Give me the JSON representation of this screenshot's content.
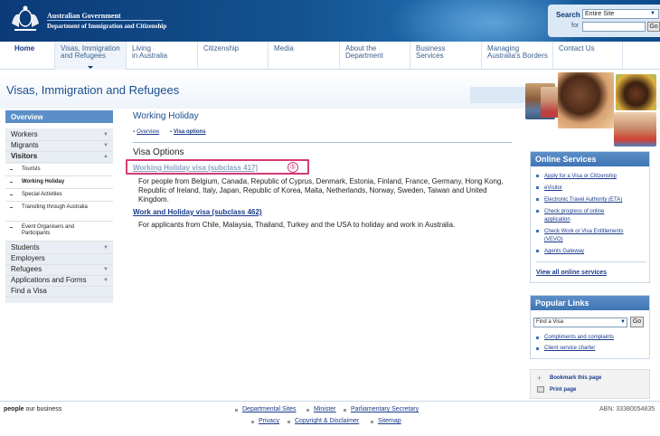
{
  "header": {
    "gov_title": "Australian Government",
    "dept_title": "Department of Immigration and Citizenship",
    "search": {
      "label": "Search",
      "scope": "Entire Site",
      "for_label": "for",
      "go": "Go"
    }
  },
  "nav": {
    "items": [
      {
        "line1": "Home",
        "line2": ""
      },
      {
        "line1": "Visas, Immigration",
        "line2": "and Refugees"
      },
      {
        "line1": "Living",
        "line2": "in Australia"
      },
      {
        "line1": "Citizenship",
        "line2": ""
      },
      {
        "line1": "Media",
        "line2": ""
      },
      {
        "line1": "About the",
        "line2": "Department"
      },
      {
        "line1": "Business",
        "line2": "Services"
      },
      {
        "line1": "Managing",
        "line2": "Australia's Borders"
      },
      {
        "line1": "Contact Us",
        "line2": ""
      }
    ]
  },
  "page_title": "Visas, Immigration and Refugees",
  "left_menu": {
    "header": "Overview",
    "items": [
      {
        "label": "Workers"
      },
      {
        "label": "Migrants"
      },
      {
        "label": "Visitors"
      },
      {
        "label": "Tourists"
      },
      {
        "label": "Working Holiday"
      },
      {
        "label": "Special Activities"
      },
      {
        "label": "Transiting through Australia"
      },
      {
        "label": "Event Organisers and Participants"
      },
      {
        "label": "Students"
      },
      {
        "label": "Employers"
      },
      {
        "label": "Refugees"
      },
      {
        "label": "Applications and Forms"
      },
      {
        "label": "Find a Visa"
      }
    ]
  },
  "main": {
    "title": "Working Holiday",
    "breadcrumb": [
      "Overview",
      "Visa options"
    ],
    "section_title": "Visa Options",
    "visas": [
      {
        "name": "Working Holiday visa (subclass 417)",
        "desc": "For people from Belgium, Canada, Republic of Cyprus, Denmark, Estonia, Finland, France, Germany, Hong Kong, Republic of Ireland, Italy, Japan, Republic of Korea, Malta, Netherlands, Norway, Sweden, Taiwan and United Kingdom."
      },
      {
        "name": "Work and Holiday visa (subclass 462)",
        "desc": "For applicants from Chile, Malaysia, Thailand, Turkey and the USA to holiday and work in Australia."
      }
    ],
    "annotation_badge": "⑤"
  },
  "online_services": {
    "title": "Online Services",
    "links": [
      "Apply for a Visa or Citizenship",
      "eVisitor",
      "Electronic Travel Authority (ETA)",
      "Check progress of online",
      "application",
      "Check Work or Visa Entitlements",
      "(VEVO)",
      "Agents Gateway"
    ],
    "view_all": "View all online services"
  },
  "popular_links": {
    "title": "Popular Links",
    "select": "Find a Visa",
    "go": "Go",
    "links": [
      "Compliments and complaints",
      "Client service charter"
    ]
  },
  "bookmark": {
    "bookmark": "Bookmark this page",
    "print": "Print page"
  },
  "footer": {
    "logo_bold": "people",
    "logo_rest": " our business",
    "links_row1": [
      "Departmental Sites",
      "Minister",
      "Parliamentary Secretary"
    ],
    "links_row2": [
      "Privacy",
      "Copyright & Disclaimer",
      "Sitemap"
    ],
    "abn": "ABN: 33380054835"
  },
  "colors": {
    "header_blue": "#0b3a78",
    "menu_blue": "#5c8fc8",
    "highlight_pink": "#d43a78",
    "link_blue": "#1a3a8a"
  }
}
